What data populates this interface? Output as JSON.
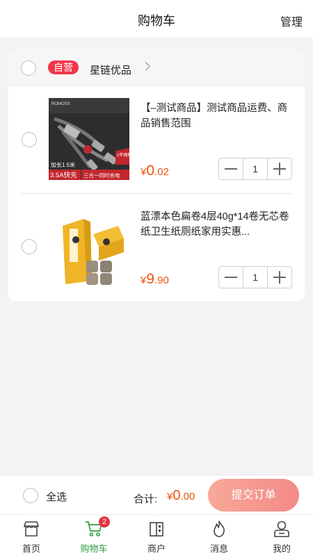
{
  "header": {
    "title": "购物车",
    "manage": "管理"
  },
  "store": {
    "badge": "自营",
    "name": "星链优品"
  },
  "items": [
    {
      "title": "【–测试商品】测试商品运费、商品销售范围",
      "price_symbol": "¥",
      "price_int": "0",
      "price_dec": ".02",
      "quantity": "1",
      "image_text": {
        "brand": "ROMOSS",
        "length": "加长1.5米",
        "fast": "3.5A快充",
        "three": "三合一同时充电",
        "tag": "1年换新"
      }
    },
    {
      "title": "蓝漂本色扁卷4层40g*14卷无芯卷纸卫生纸厕纸家用实惠...",
      "price_symbol": "¥",
      "price_int": "9",
      "price_dec": ".90",
      "quantity": "1"
    }
  ],
  "footer": {
    "select_all": "全选",
    "total_label": "合计:",
    "total_symbol": "¥",
    "total_int": "0",
    "total_dec": ".00",
    "submit": "提交订单"
  },
  "tabbar": {
    "items": [
      {
        "label": "首页",
        "icon": "home-store-icon"
      },
      {
        "label": "购物车",
        "icon": "cart-icon",
        "badge": "2"
      },
      {
        "label": "商户",
        "icon": "merchant-icon"
      },
      {
        "label": "消息",
        "icon": "message-flame-icon"
      },
      {
        "label": "我的",
        "icon": "profile-icon"
      }
    ]
  },
  "colors": {
    "accent": "#f0530f",
    "badge": "#f2384b",
    "active_tab": "#2f9d41",
    "submit_start": "#f8a89a",
    "submit_end": "#f38a86"
  }
}
